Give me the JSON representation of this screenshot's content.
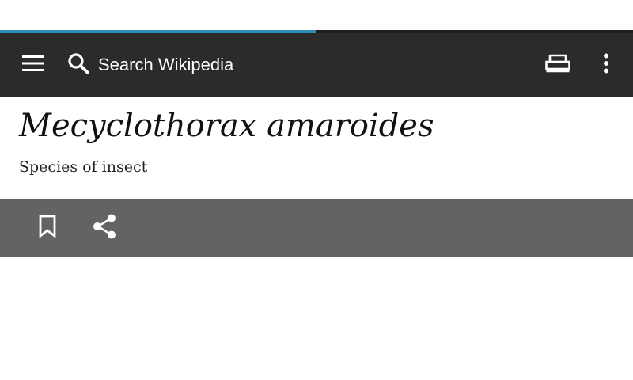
{
  "progress": {
    "fraction": 0.5,
    "color": "#2a8fb3"
  },
  "toolbar": {
    "menu_icon": "hamburger-menu-icon",
    "search_icon": "search-icon",
    "search_label": "Search Wikipedia",
    "reading_icon": "reading-list-icon",
    "overflow_icon": "overflow-menu-icon",
    "background": "#2b2b2b"
  },
  "article": {
    "title": "Mecyclothorax amaroides",
    "description": "Species of insect"
  },
  "actions": {
    "bookmark_icon": "bookmark-icon",
    "share_icon": "share-icon",
    "background": "#636363"
  }
}
